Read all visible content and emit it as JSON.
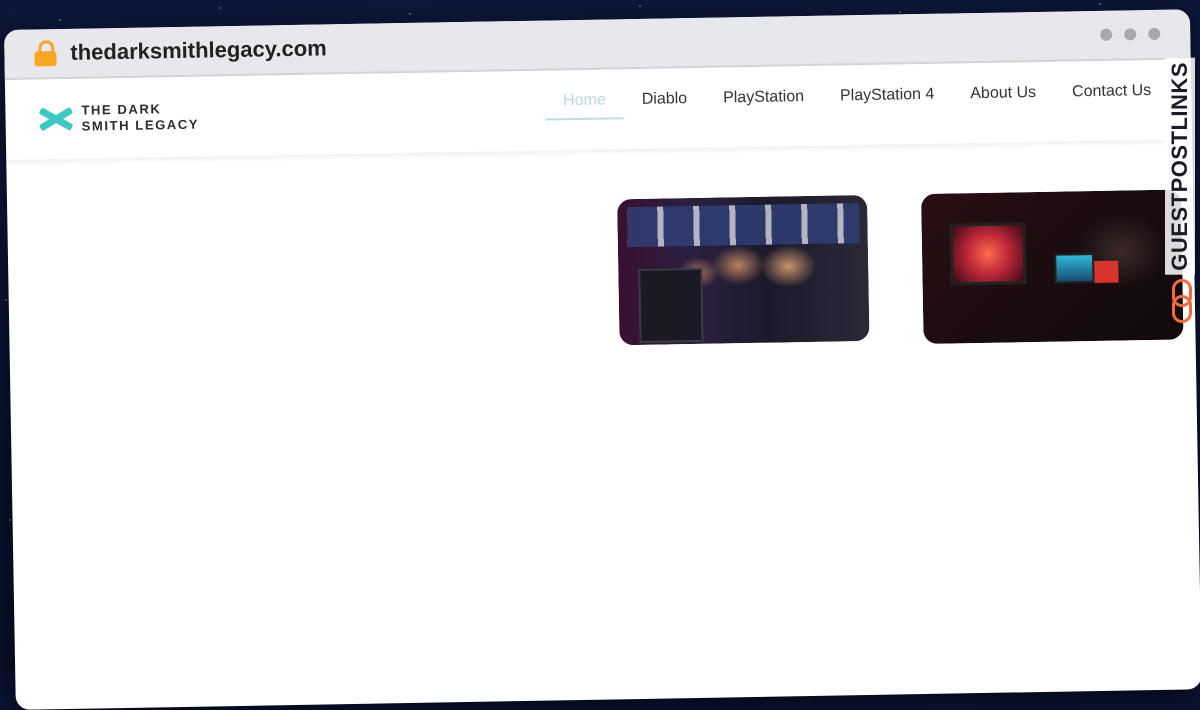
{
  "browser": {
    "url": "thedarksmithlegacy.com",
    "lock_icon": "lock-icon",
    "window_controls": [
      "dot",
      "dot",
      "dot"
    ]
  },
  "site": {
    "logo_line1": "THE DARK",
    "logo_line2": "SMITH LEGACY",
    "logo_icon": "asterisk-logo-icon",
    "accent": "#3fc8c2",
    "nav": [
      {
        "label": "Home",
        "active": true
      },
      {
        "label": "Diablo"
      },
      {
        "label": "PlayStation"
      },
      {
        "label": "PlayStation 4"
      },
      {
        "label": "About Us"
      },
      {
        "label": "Contact Us"
      }
    ]
  },
  "images": {
    "image1": "gamers-group-photo",
    "image2": "gamer-at-desk-photo"
  },
  "watermark": {
    "text": "GUESTPOSTLINKS",
    "icon": "chain-link-icon",
    "color": "#f26b3a"
  }
}
